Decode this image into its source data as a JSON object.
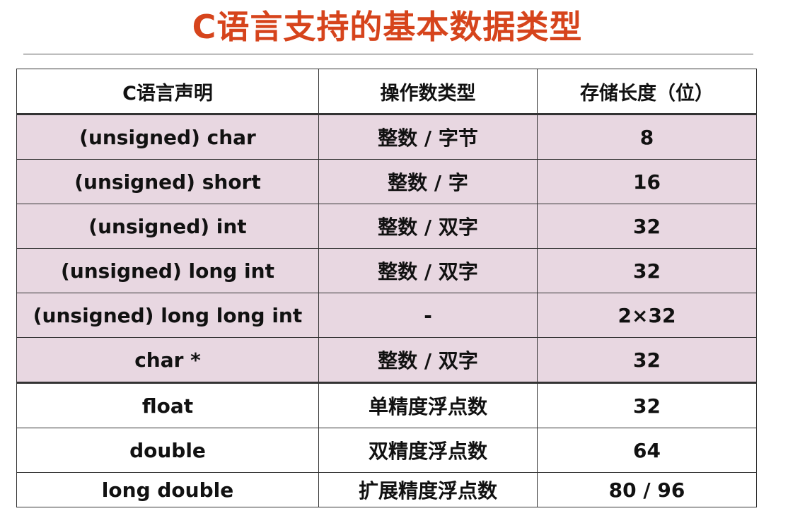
{
  "slide": {
    "title_prefix": "C",
    "title_rest": "语言支持的基本数据类型",
    "colors": {
      "title_accent": "#d6441c",
      "shaded_row": "#e8d7e1",
      "border": "#333333"
    }
  },
  "table": {
    "headers": [
      "C语言声明",
      "操作数类型",
      "存储长度（位）"
    ],
    "rows": [
      {
        "decl": "(unsigned) char",
        "type": "整数 / 字节",
        "bits": "8",
        "shaded": true
      },
      {
        "decl": "(unsigned) short",
        "type": "整数 / 字",
        "bits": "16",
        "shaded": true
      },
      {
        "decl": "(unsigned) int",
        "type": "整数 / 双字",
        "bits": "32",
        "shaded": true
      },
      {
        "decl": "(unsigned) long int",
        "type": "整数 / 双字",
        "bits": "32",
        "shaded": true
      },
      {
        "decl": "(unsigned) long long int",
        "type": "-",
        "bits": "2×32",
        "shaded": true
      },
      {
        "decl": "char *",
        "type": "整数 / 双字",
        "bits": "32",
        "shaded": true
      },
      {
        "decl": "float",
        "type": "单精度浮点数",
        "bits": "32",
        "shaded": false
      },
      {
        "decl": "double",
        "type": "双精度浮点数",
        "bits": "64",
        "shaded": false
      },
      {
        "decl": "long double",
        "type": "扩展精度浮点数",
        "bits": "80 / 96",
        "shaded": false
      }
    ]
  }
}
